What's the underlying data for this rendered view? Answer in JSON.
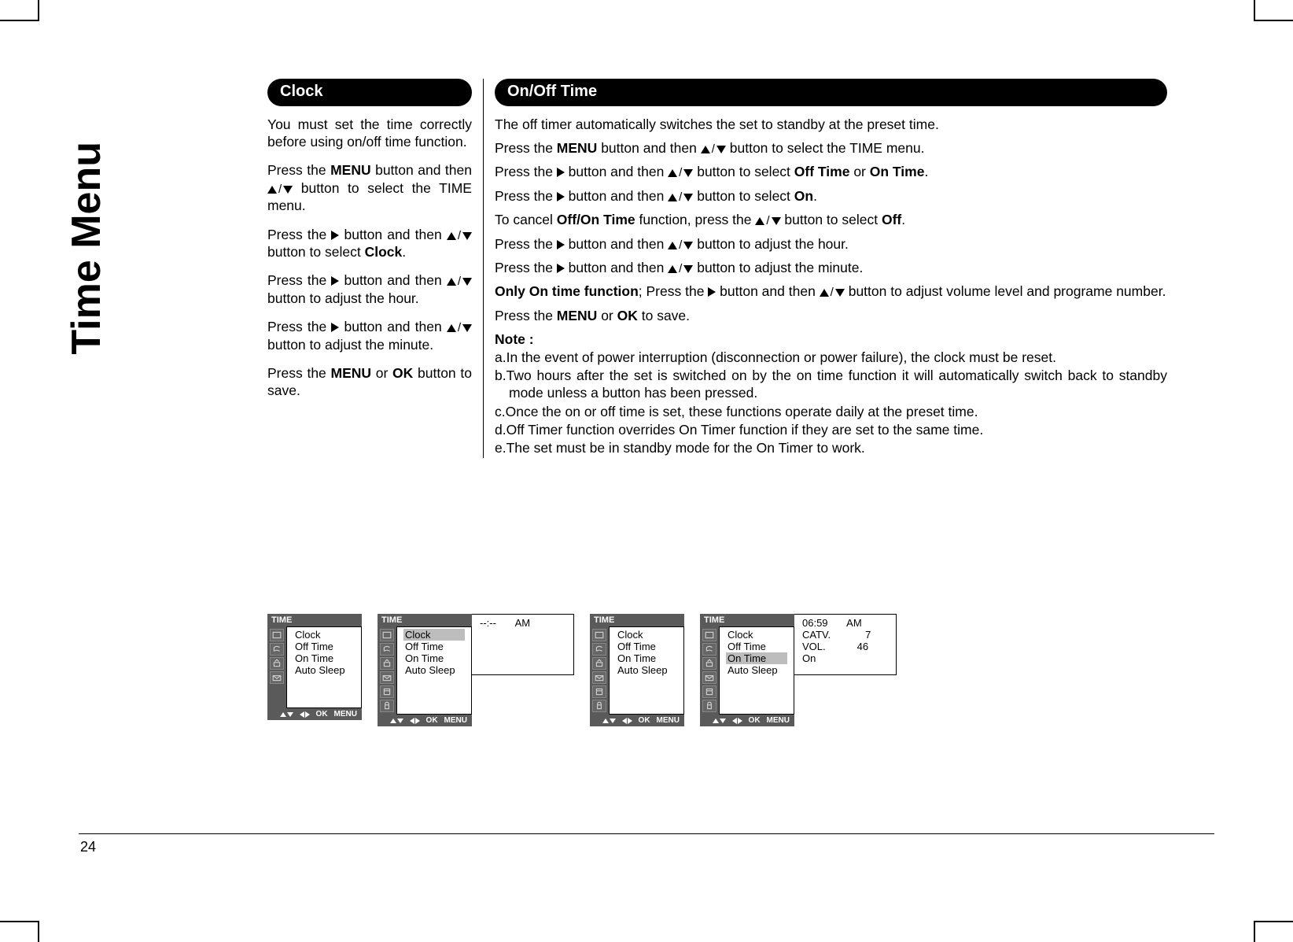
{
  "side_title": "Time Menu",
  "page_number": "24",
  "clock": {
    "heading": "Clock",
    "p1_a": "You must set the time correctly before using on/off time function.",
    "p2_a": "Press the ",
    "p2_menu": "MENU",
    "p2_b": " button and then ",
    "p2_c": " button to select the TIME menu.",
    "p3_a": "Press the ",
    "p3_b": " button and then ",
    "p3_c": " button to select ",
    "p3_clock": "Clock",
    "p3_d": ".",
    "p4_a": "Press the ",
    "p4_b": " button and then ",
    "p4_c": " button to adjust the hour.",
    "p5_a": "Press the ",
    "p5_b": " button and then ",
    "p5_c": " button to adjust the minute.",
    "p6_a": "Press the ",
    "p6_menu": "MENU",
    "p6_or": " or ",
    "p6_ok": "OK",
    "p6_b": " button to save."
  },
  "onoff": {
    "heading": "On/Off Time",
    "p1": "The off timer automatically switches the set to standby at the preset time.",
    "p2_a": "Press the ",
    "p2_menu": "MENU",
    "p2_b": " button and then ",
    "p2_c": " button to select the TIME menu.",
    "p3_a": "Press the ",
    "p3_b": " button and then ",
    "p3_c": " button to select ",
    "p3_off": "Off Time",
    "p3_or": " or ",
    "p3_on": "On Time",
    "p3_d": ".",
    "p4_a": "Press the ",
    "p4_b": " button and then ",
    "p4_c": " button to select ",
    "p4_on": "On",
    "p4_d": ".",
    "p5_a": "To cancel ",
    "p5_offon": "Off/On Time",
    "p5_b": " function, press the ",
    "p5_c": " button to select ",
    "p5_off": "Off",
    "p5_d": ".",
    "p6_a": "Press the ",
    "p6_b": " button and then ",
    "p6_c": " button to adjust the hour.",
    "p7_a": "Press the ",
    "p7_b": " button and then ",
    "p7_c": " button to adjust the minute.",
    "p8_only": "Only On time function",
    "p8_a": "; Press the ",
    "p8_b": " button and then ",
    "p8_c": " button to adjust volume level and programe number.",
    "p9_a": "Press the ",
    "p9_menu": "MENU",
    "p9_or": " or ",
    "p9_ok": "OK",
    "p9_b": " to save.",
    "note_label": "Note :",
    "note_a": "a.In the event of power interruption (disconnection or power failure), the clock must be reset.",
    "note_b": "b.Two hours after the set is switched on by the on time function it will automatically switch back to standby mode unless a button has been pressed.",
    "note_c": "c.Once the on or off time is set, these functions operate daily at the preset time.",
    "note_d": "d.Off Timer function overrides On Timer function if they are set to the same time.",
    "note_e": "e.The set must be in standby mode for the On Timer to work."
  },
  "osd_common": {
    "title": "TIME",
    "items": [
      "Clock",
      "Off Time",
      "On Time",
      "Auto Sleep"
    ],
    "footer_ok": "OK",
    "footer_menu": "MENU"
  },
  "osd1": {
    "icon_count": 4,
    "selected_index": null
  },
  "osd2": {
    "icon_count": 6,
    "selected_index": 0,
    "detail": {
      "time": "--:--",
      "ampm": "AM"
    }
  },
  "osd3": {
    "icon_count": 6,
    "selected_index": null
  },
  "osd4": {
    "icon_count": 6,
    "selected_index": 2,
    "detail": {
      "time": "06:59",
      "ampm": "AM",
      "catv_label": "CATV.",
      "catv_value": "7",
      "vol_label": "VOL.",
      "vol_value": "46",
      "state": "On"
    }
  }
}
